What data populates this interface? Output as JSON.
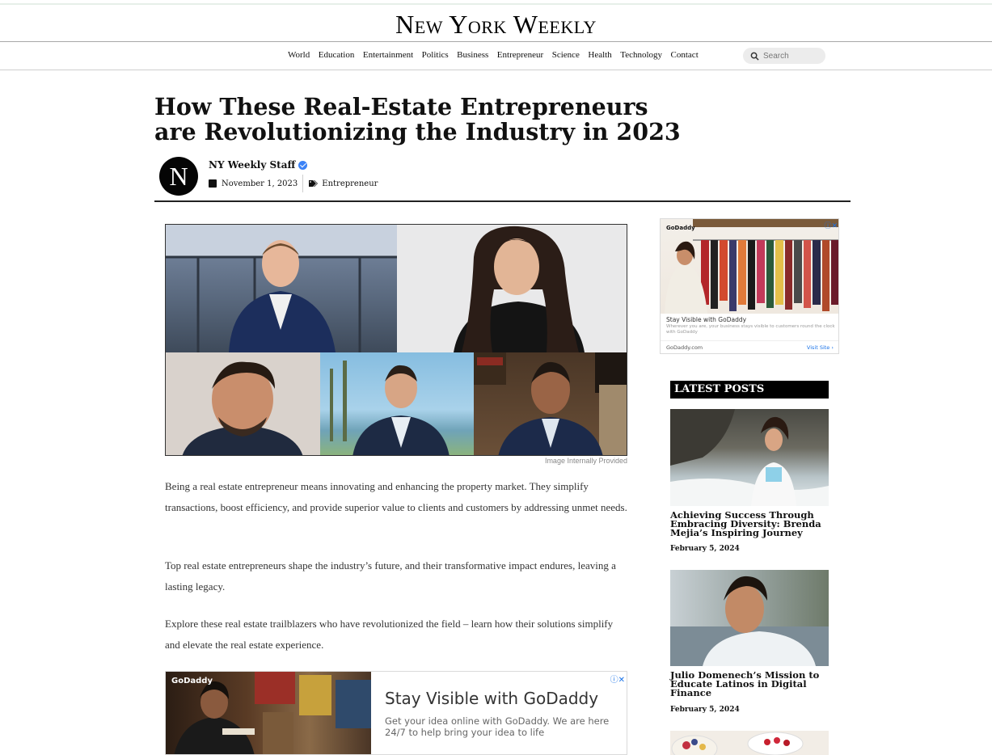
{
  "site": {
    "logo": "New York Weekly"
  },
  "nav": {
    "items": [
      "World",
      "Education",
      "Entertainment",
      "Politics",
      "Business",
      "Entrepreneur",
      "Science",
      "Health",
      "Technology",
      "Contact"
    ],
    "search_placeholder": "Search"
  },
  "article": {
    "title": "How These Real-Estate Entrepreneurs are Revolutionizing the Industry in 2023",
    "avatar_letter": "N",
    "author": "NY Weekly Staff",
    "date": "November 1, 2023",
    "category": "Entrepreneur",
    "image_caption": "Image Internally Provided",
    "paragraphs": [
      "Being a real estate entrepreneur means innovating and enhancing the property market. They simplify transactions, boost efficiency, and provide superior value to clients and customers by addressing unmet needs.",
      "Top real estate entrepreneurs shape the industry’s future, and their transformative impact endures, leaving a lasting legacy.",
      "Explore these real estate trailblazers who have revolutionized the field – learn how their solutions simplify and elevate the real estate experience."
    ]
  },
  "ad_bottom": {
    "brand": "GoDaddy",
    "title": "Stay Visible with GoDaddy",
    "subtitle": "Get your idea online with GoDaddy. We are here 24/7 to help bring your idea to life"
  },
  "ad_side": {
    "brand": "GoDaddy",
    "title": "Stay Visible with GoDaddy",
    "subtitle": "Wherever you are, your business stays visible to customers round the clock with GoDaddy",
    "domain": "GoDaddy.com",
    "visit": "Visit Site"
  },
  "sidebar": {
    "heading": "LATEST POSTS",
    "posts": [
      {
        "title": "Achieving Success Through Embracing Diversity: Brenda Mejia’s Inspiring Journey",
        "date": "February 5, 2024"
      },
      {
        "title": "Julio Domenech’s Mission to Educate Latinos in Digital Finance",
        "date": "February 5, 2024"
      }
    ]
  }
}
